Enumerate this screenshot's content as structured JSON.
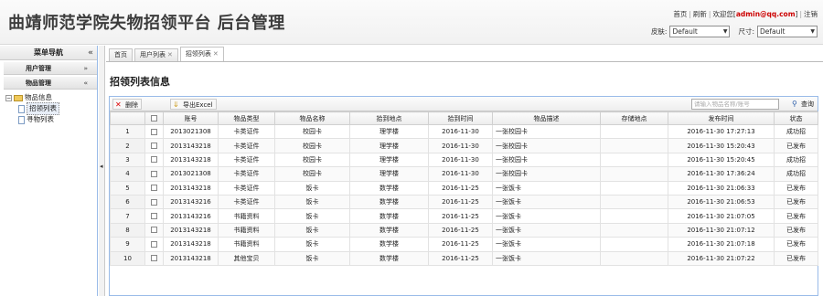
{
  "header": {
    "title": "曲靖师范学院失物招领平台 后台管理",
    "links": {
      "home": "首页",
      "refresh": "刷新",
      "welcome": "欢迎您[",
      "email": "admin@qq.com",
      "welcome_end": "]",
      "logout": "注销"
    },
    "skin_label": "皮肤:",
    "skin_value": "Default",
    "size_label": "尺寸:",
    "size_value": "Default"
  },
  "sidebar": {
    "title": "菜单导航",
    "collapse": "«",
    "sections": [
      {
        "label": "用户管理",
        "chevron": "»"
      },
      {
        "label": "物品管理",
        "chevron": "«"
      }
    ],
    "tree": {
      "root": "物品信息",
      "children": [
        "招领列表",
        "寻物列表"
      ]
    }
  },
  "tabs": [
    {
      "label": "首页",
      "closable": false
    },
    {
      "label": "用户列表",
      "closable": true
    },
    {
      "label": "招领列表",
      "closable": true,
      "active": true
    }
  ],
  "page_title": "招领列表信息",
  "toolbar": {
    "delete_label": "删除",
    "export_label": "导出Excel",
    "search_placeholder": "请输入物品名称/账号",
    "search_label": "查询"
  },
  "table": {
    "columns": [
      "",
      "",
      "账号",
      "物品类型",
      "物品名称",
      "拾到地点",
      "拾到时间",
      "物品描述",
      "存储地点",
      "发布时间",
      "状态"
    ],
    "rows": [
      [
        "1",
        "2013021308",
        "卡类证件",
        "校园卡",
        "理学楼",
        "2016-11-30",
        "一张校园卡",
        "",
        "2016-11-30 17:27:13",
        "成功招"
      ],
      [
        "2",
        "2013143218",
        "卡类证件",
        "校园卡",
        "理学楼",
        "2016-11-30",
        "一张校园卡",
        "",
        "2016-11-30 15:20:43",
        "已发布"
      ],
      [
        "3",
        "2013143218",
        "卡类证件",
        "校园卡",
        "理学楼",
        "2016-11-30",
        "一张校园卡",
        "",
        "2016-11-30 15:20:45",
        "成功招"
      ],
      [
        "4",
        "2013021308",
        "卡类证件",
        "校园卡",
        "理学楼",
        "2016-11-30",
        "一张校园卡",
        "",
        "2016-11-30 17:36:24",
        "成功招"
      ],
      [
        "5",
        "2013143218",
        "卡类证件",
        "饭卡",
        "数学楼",
        "2016-11-25",
        "一张饭卡",
        "",
        "2016-11-30 21:06:33",
        "已发布"
      ],
      [
        "6",
        "2013143216",
        "卡类证件",
        "饭卡",
        "数学楼",
        "2016-11-25",
        "一张饭卡",
        "",
        "2016-11-30 21:06:53",
        "已发布"
      ],
      [
        "7",
        "2013143216",
        "书籍资料",
        "饭卡",
        "数学楼",
        "2016-11-25",
        "一张饭卡",
        "",
        "2016-11-30 21:07:05",
        "已发布"
      ],
      [
        "8",
        "2013143218",
        "书籍资料",
        "饭卡",
        "数学楼",
        "2016-11-25",
        "一张饭卡",
        "",
        "2016-11-30 21:07:12",
        "已发布"
      ],
      [
        "9",
        "2013143218",
        "书籍资料",
        "饭卡",
        "数学楼",
        "2016-11-25",
        "一张饭卡",
        "",
        "2016-11-30 21:07:18",
        "已发布"
      ],
      [
        "10",
        "2013143218",
        "其他宝贝",
        "饭卡",
        "数学楼",
        "2016-11-25",
        "一张饭卡",
        "",
        "2016-11-30 21:07:22",
        "已发布"
      ]
    ]
  }
}
